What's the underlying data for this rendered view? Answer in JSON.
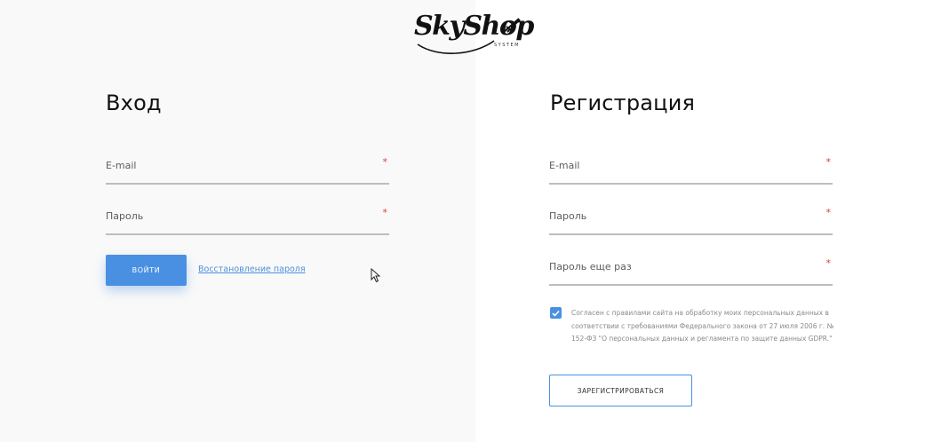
{
  "logo": {
    "word": "SkyShop",
    "sub": "SYSTEM"
  },
  "login": {
    "title": "Вход",
    "email_label": "E-mail",
    "password_label": "Пароль",
    "required_mark": "*",
    "submit_label": "ВОЙТИ",
    "recover_link": "Восстановление пароля"
  },
  "register": {
    "title": "Регистрация",
    "email_label": "E-mail",
    "password_label": "Пароль",
    "password_repeat_label": "Пароль еще раз",
    "required_mark": "*",
    "consent_text": "Согласен с правилами сайта на обработку моих персональных данных в соответствии с требованиями Федерального закона от 27 июля 2006 г. № 152-ФЗ \"О персональных данных и регламента по защите данных GDPR.\"",
    "consent_checked": true,
    "submit_label": "ЗАРЕГИСТРИРОВАТЬСЯ"
  },
  "colors": {
    "accent": "#4a90e2",
    "required": "#e53935",
    "left_panel_bg": "#f9f9f9"
  },
  "icons": [
    "skyshop-logo",
    "plane-icon",
    "checkmark-icon",
    "mouse-cursor-icon"
  ]
}
